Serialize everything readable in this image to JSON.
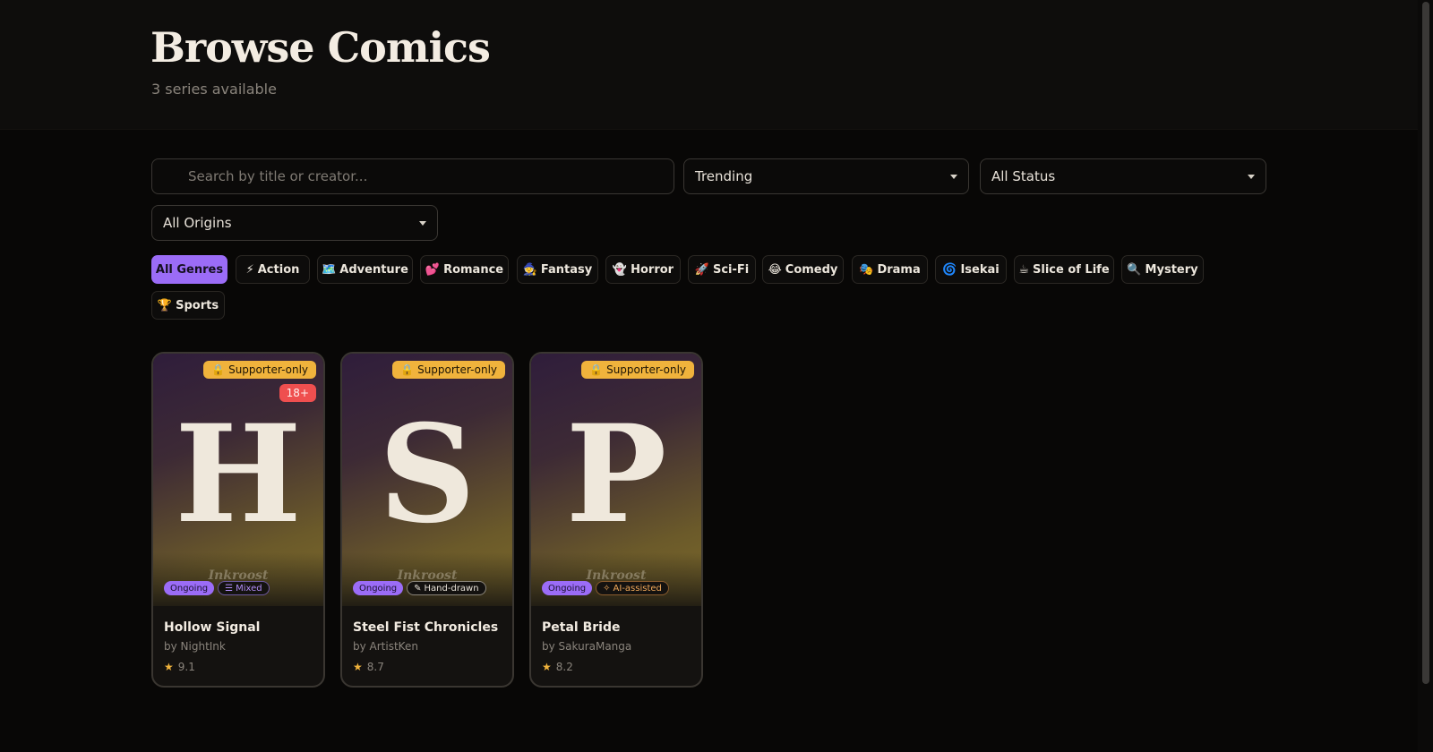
{
  "header": {
    "title": "Browse Comics",
    "subtitle": "3 series available"
  },
  "filters": {
    "search_placeholder": "Search by title or creator...",
    "sort_value": "Trending",
    "status_value": "All Status",
    "origin_value": "All Origins"
  },
  "genres": [
    {
      "emoji": "",
      "label": "All Genres",
      "active": true
    },
    {
      "emoji": "⚡",
      "label": "Action"
    },
    {
      "emoji": "🗺️",
      "label": "Adventure"
    },
    {
      "emoji": "💕",
      "label": "Romance"
    },
    {
      "emoji": "🧙",
      "label": "Fantasy"
    },
    {
      "emoji": "👻",
      "label": "Horror"
    },
    {
      "emoji": "🚀",
      "label": "Sci-Fi"
    },
    {
      "emoji": "😂",
      "label": "Comedy"
    },
    {
      "emoji": "🎭",
      "label": "Drama"
    },
    {
      "emoji": "🌀",
      "label": "Isekai"
    },
    {
      "emoji": "☕",
      "label": "Slice of Life"
    },
    {
      "emoji": "🔍",
      "label": "Mystery"
    },
    {
      "emoji": "🏆",
      "label": "Sports"
    }
  ],
  "comics": [
    {
      "letter": "H",
      "watermark": "Inkroost",
      "supporter_badge": "Supporter-only",
      "age_badge": "18+",
      "status": "Ongoing",
      "origin": "Mixed",
      "title": "Hollow Signal",
      "creator": "by NightInk",
      "rating": "9.1"
    },
    {
      "letter": "S",
      "watermark": "Inkroost",
      "supporter_badge": "Supporter-only",
      "status": "Ongoing",
      "origin": "Hand-drawn",
      "title": "Steel Fist Chronicles",
      "creator": "by ArtistKen",
      "rating": "8.7"
    },
    {
      "letter": "P",
      "watermark": "Inkroost",
      "supporter_badge": "Supporter-only",
      "status": "Ongoing",
      "origin": "AI-assisted",
      "title": "Petal Bride",
      "creator": "by SakuraManga",
      "rating": "8.2"
    }
  ],
  "colors": {
    "accent": "#9b6cf7",
    "supporter": "#f0b33c",
    "age": "#ef4f4f",
    "background": "#080706"
  },
  "icons": {
    "lock": "lock-icon",
    "star": "star-icon",
    "search": "search-icon"
  }
}
